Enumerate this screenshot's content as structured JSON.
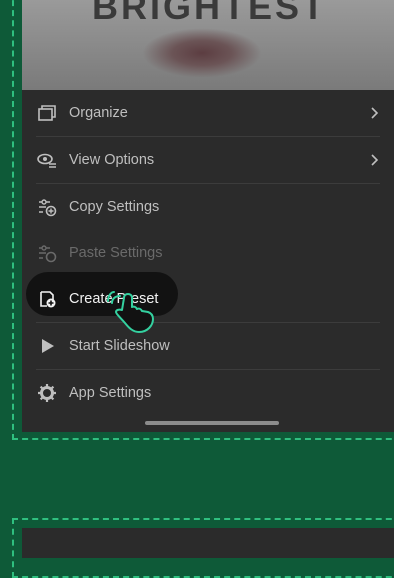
{
  "hero": {
    "title": "BRIGHTEST"
  },
  "menu": {
    "items": [
      {
        "label": "Organize",
        "icon": "organize-icon",
        "has_submenu": true
      },
      {
        "label": "View Options",
        "icon": "view-options-icon",
        "has_submenu": true
      },
      {
        "label": "Copy Settings",
        "icon": "copy-settings-icon"
      },
      {
        "label": "Paste Settings",
        "icon": "paste-settings-icon",
        "disabled": true
      },
      {
        "label": "Create Preset",
        "icon": "create-preset-icon",
        "highlighted": true
      },
      {
        "label": "Start Slideshow",
        "icon": "play-icon"
      },
      {
        "label": "App Settings",
        "icon": "gear-icon"
      }
    ]
  },
  "colors": {
    "background": "#0e5a38",
    "dashed_border": "#2fbf7f",
    "panel": "#2b2b2b",
    "accent_pointer": "#34d1a0"
  }
}
